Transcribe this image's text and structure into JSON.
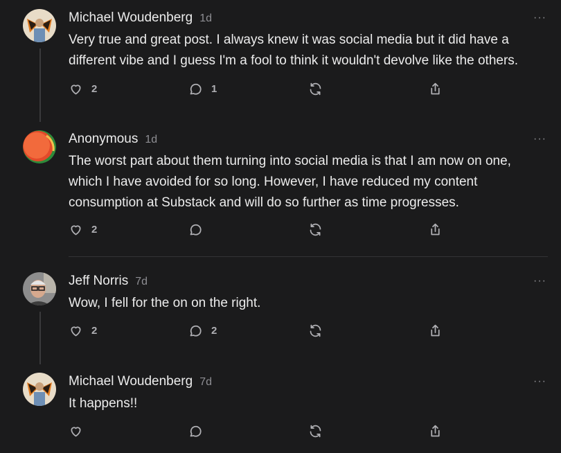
{
  "comments": [
    {
      "author": "Michael Woudenberg",
      "time": "1d",
      "more": "···",
      "lines": [
        "Very true and great post. I always knew it was social media but it did have a",
        "different vibe and I guess I'm a fool to think it wouldn't devolve like the others."
      ],
      "likes": "2",
      "replies": "1"
    },
    {
      "author": "Anonymous",
      "time": "1d",
      "more": "···",
      "lines": [
        "The worst part about them turning into social media is that I am now on one,",
        "which I have avoided for so long. However, I have reduced my content",
        "consumption at Substack and will do so further as time progresses."
      ],
      "likes": "2",
      "replies": ""
    },
    {
      "author": "Jeff Norris",
      "time": "7d",
      "more": "···",
      "lines": [
        "Wow, I fell for the on on the right."
      ],
      "likes": "2",
      "replies": "2"
    },
    {
      "author": "Michael Woudenberg",
      "time": "7d",
      "more": "···",
      "lines": [
        "It happens!!"
      ],
      "likes": "",
      "replies": ""
    }
  ]
}
